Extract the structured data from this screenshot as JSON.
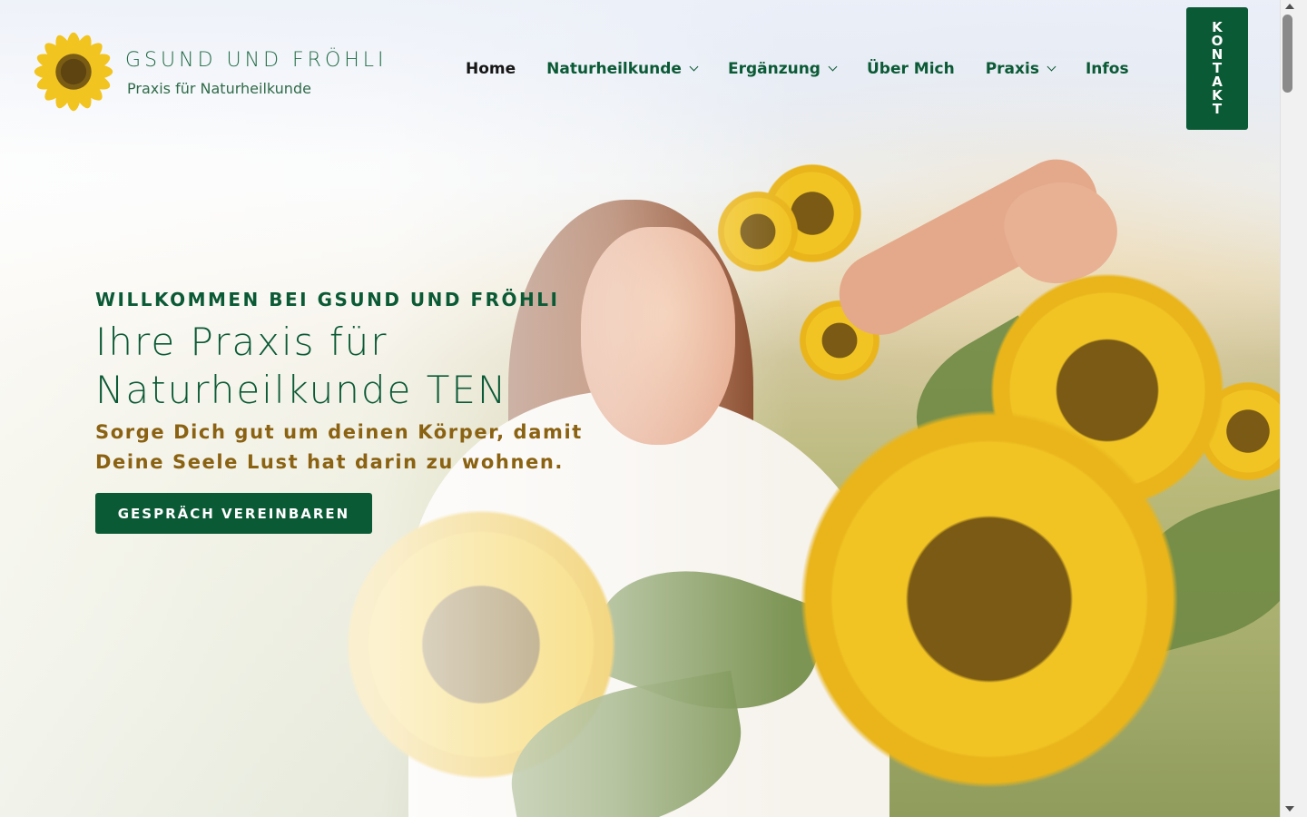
{
  "site": {
    "logo_title": "GSUND UND FRÖHLI",
    "logo_subtitle": "Praxis für Naturheilkunde"
  },
  "nav": {
    "items": [
      {
        "label": "Home",
        "dropdown": false,
        "active": true
      },
      {
        "label": "Naturheilkunde",
        "dropdown": true,
        "active": false
      },
      {
        "label": "Ergänzung",
        "dropdown": true,
        "active": false
      },
      {
        "label": "Über Mich",
        "dropdown": false,
        "active": false
      },
      {
        "label": "Praxis",
        "dropdown": true,
        "active": false
      },
      {
        "label": "Infos",
        "dropdown": false,
        "active": false
      }
    ],
    "contact_label": "KONTAKT"
  },
  "hero": {
    "eyebrow": "WILLKOMMEN BEI GSUND UND FRÖHLI",
    "headline_line1": "Ihre Praxis für",
    "headline_line2": "Naturheilkunde TEN",
    "tagline_line1": "Sorge Dich gut um deinen Körper, damit",
    "tagline_line2": "Deine Seele Lust hat darin zu wohnen.",
    "cta_label": "GESPRÄCH VEREINBAREN"
  },
  "icons": {
    "logo": "sunflower-logo-icon",
    "dropdown": "chevron-down-icon"
  },
  "colors": {
    "brand_green": "#0b5a36",
    "accent_gold": "#8a6212",
    "sunflower_yellow": "#f1c424"
  }
}
